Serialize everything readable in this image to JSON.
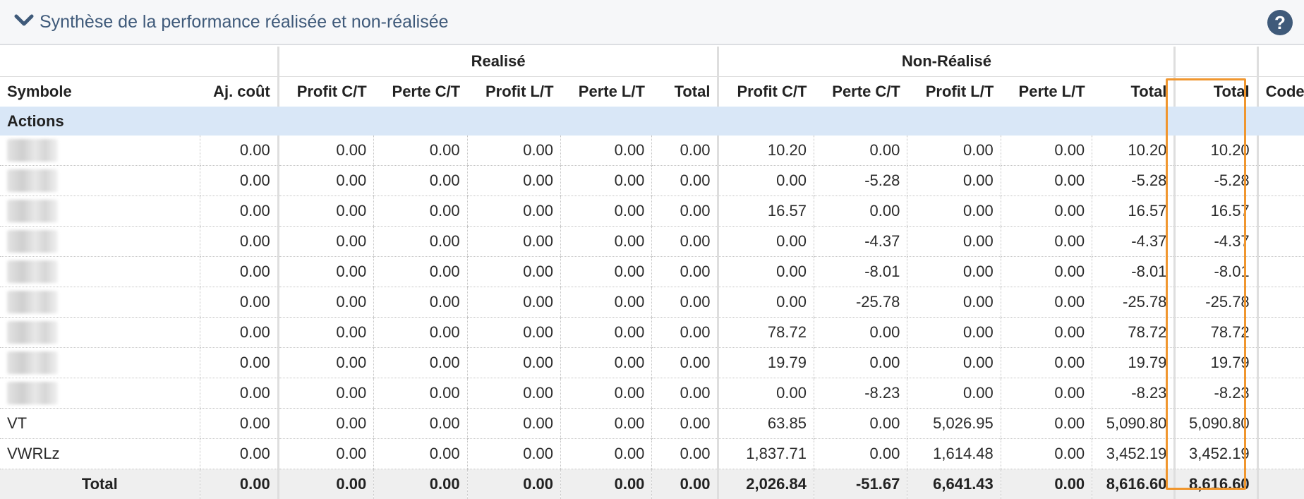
{
  "panel": {
    "title": "Synthèse de la performance réalisée et non-réalisée",
    "chevron_icon": "chevron-down-icon",
    "help_icon": "help-icon",
    "accent": "#3f5a7a",
    "highlight_color": "#f0962e"
  },
  "groups": {
    "realized": "Realisé",
    "unrealized": "Non-Réalisé"
  },
  "columns": {
    "symbol": "Symbole",
    "adj_cost": "Aj. coût",
    "r_profit_st": "Profit C/T",
    "r_loss_st": "Perte C/T",
    "r_profit_lt": "Profit L/T",
    "r_loss_lt": "Perte L/T",
    "r_total": "Total",
    "u_profit_st": "Profit C/T",
    "u_loss_st": "Perte C/T",
    "u_profit_lt": "Profit L/T",
    "u_loss_lt": "Perte L/T",
    "u_total": "Total",
    "total": "Total",
    "code": "Code"
  },
  "section": {
    "label": "Actions"
  },
  "rows": [
    {
      "symbol": "",
      "adj": "0.00",
      "r": [
        "0.00",
        "0.00",
        "0.00",
        "0.00",
        "0.00"
      ],
      "u": [
        "10.20",
        "0.00",
        "0.00",
        "0.00",
        "10.20"
      ],
      "total": "10.20",
      "code": ""
    },
    {
      "symbol": "",
      "adj": "0.00",
      "r": [
        "0.00",
        "0.00",
        "0.00",
        "0.00",
        "0.00"
      ],
      "u": [
        "0.00",
        "-5.28",
        "0.00",
        "0.00",
        "-5.28"
      ],
      "total": "-5.28",
      "code": ""
    },
    {
      "symbol": "",
      "adj": "0.00",
      "r": [
        "0.00",
        "0.00",
        "0.00",
        "0.00",
        "0.00"
      ],
      "u": [
        "16.57",
        "0.00",
        "0.00",
        "0.00",
        "16.57"
      ],
      "total": "16.57",
      "code": ""
    },
    {
      "symbol": "",
      "adj": "0.00",
      "r": [
        "0.00",
        "0.00",
        "0.00",
        "0.00",
        "0.00"
      ],
      "u": [
        "0.00",
        "-4.37",
        "0.00",
        "0.00",
        "-4.37"
      ],
      "total": "-4.37",
      "code": ""
    },
    {
      "symbol": "",
      "adj": "0.00",
      "r": [
        "0.00",
        "0.00",
        "0.00",
        "0.00",
        "0.00"
      ],
      "u": [
        "0.00",
        "-8.01",
        "0.00",
        "0.00",
        "-8.01"
      ],
      "total": "-8.01",
      "code": ""
    },
    {
      "symbol": "",
      "adj": "0.00",
      "r": [
        "0.00",
        "0.00",
        "0.00",
        "0.00",
        "0.00"
      ],
      "u": [
        "0.00",
        "-25.78",
        "0.00",
        "0.00",
        "-25.78"
      ],
      "total": "-25.78",
      "code": ""
    },
    {
      "symbol": "",
      "adj": "0.00",
      "r": [
        "0.00",
        "0.00",
        "0.00",
        "0.00",
        "0.00"
      ],
      "u": [
        "78.72",
        "0.00",
        "0.00",
        "0.00",
        "78.72"
      ],
      "total": "78.72",
      "code": ""
    },
    {
      "symbol": "",
      "adj": "0.00",
      "r": [
        "0.00",
        "0.00",
        "0.00",
        "0.00",
        "0.00"
      ],
      "u": [
        "19.79",
        "0.00",
        "0.00",
        "0.00",
        "19.79"
      ],
      "total": "19.79",
      "code": ""
    },
    {
      "symbol": "",
      "adj": "0.00",
      "r": [
        "0.00",
        "0.00",
        "0.00",
        "0.00",
        "0.00"
      ],
      "u": [
        "0.00",
        "-8.23",
        "0.00",
        "0.00",
        "-8.23"
      ],
      "total": "-8.23",
      "code": ""
    },
    {
      "symbol": "VT",
      "adj": "0.00",
      "r": [
        "0.00",
        "0.00",
        "0.00",
        "0.00",
        "0.00"
      ],
      "u": [
        "63.85",
        "0.00",
        "5,026.95",
        "0.00",
        "5,090.80"
      ],
      "total": "5,090.80",
      "code": ""
    },
    {
      "symbol": "VWRLz",
      "adj": "0.00",
      "r": [
        "0.00",
        "0.00",
        "0.00",
        "0.00",
        "0.00"
      ],
      "u": [
        "1,837.71",
        "0.00",
        "1,614.48",
        "0.00",
        "3,452.19"
      ],
      "total": "3,452.19",
      "code": ""
    }
  ],
  "totals": {
    "label": "Total",
    "adj": "0.00",
    "r": [
      "0.00",
      "0.00",
      "0.00",
      "0.00",
      "0.00"
    ],
    "u": [
      "2,026.84",
      "-51.67",
      "6,641.43",
      "0.00",
      "8,616.60"
    ],
    "total": "8,616.60"
  }
}
